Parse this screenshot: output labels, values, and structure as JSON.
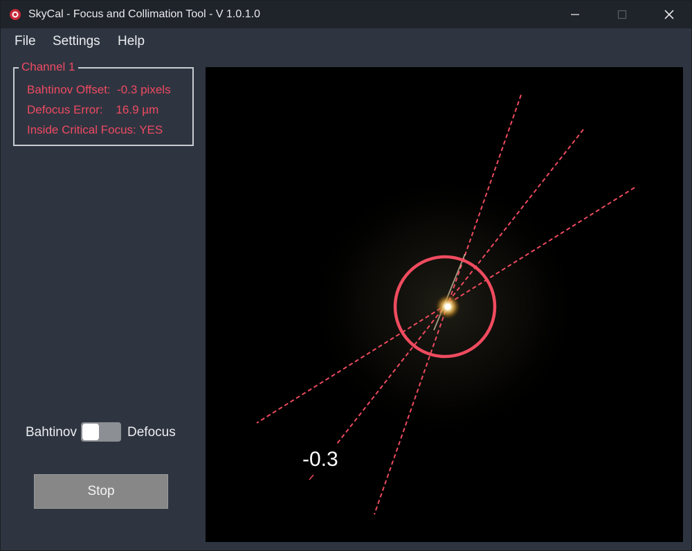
{
  "window": {
    "title": "SkyCal - Focus and Collimation Tool - V 1.0.1.0",
    "controls": [
      "minimize-icon",
      "maximize-icon",
      "close-icon"
    ]
  },
  "menu": {
    "file": "File",
    "settings": "Settings",
    "help": "Help"
  },
  "channel": {
    "title": "Channel 1",
    "bahtinov_offset": "Bahtinov Offset:  -0.3 pixels",
    "defocus_error": "Defocus Error:    16.9 µm",
    "critical_focus": "Inside Critical Focus: YES"
  },
  "mode_toggle": {
    "left_label": "Bahtinov",
    "right_label": "Defocus",
    "state": "Bahtinov"
  },
  "stop_button": "Stop",
  "viewer": {
    "offset_value": "-0.3"
  },
  "colors": {
    "accent_red": "#ee4a63",
    "panel_bg": "#2f3540",
    "titlebar_bg": "#1f232a",
    "viewer_bg": "#000000"
  }
}
